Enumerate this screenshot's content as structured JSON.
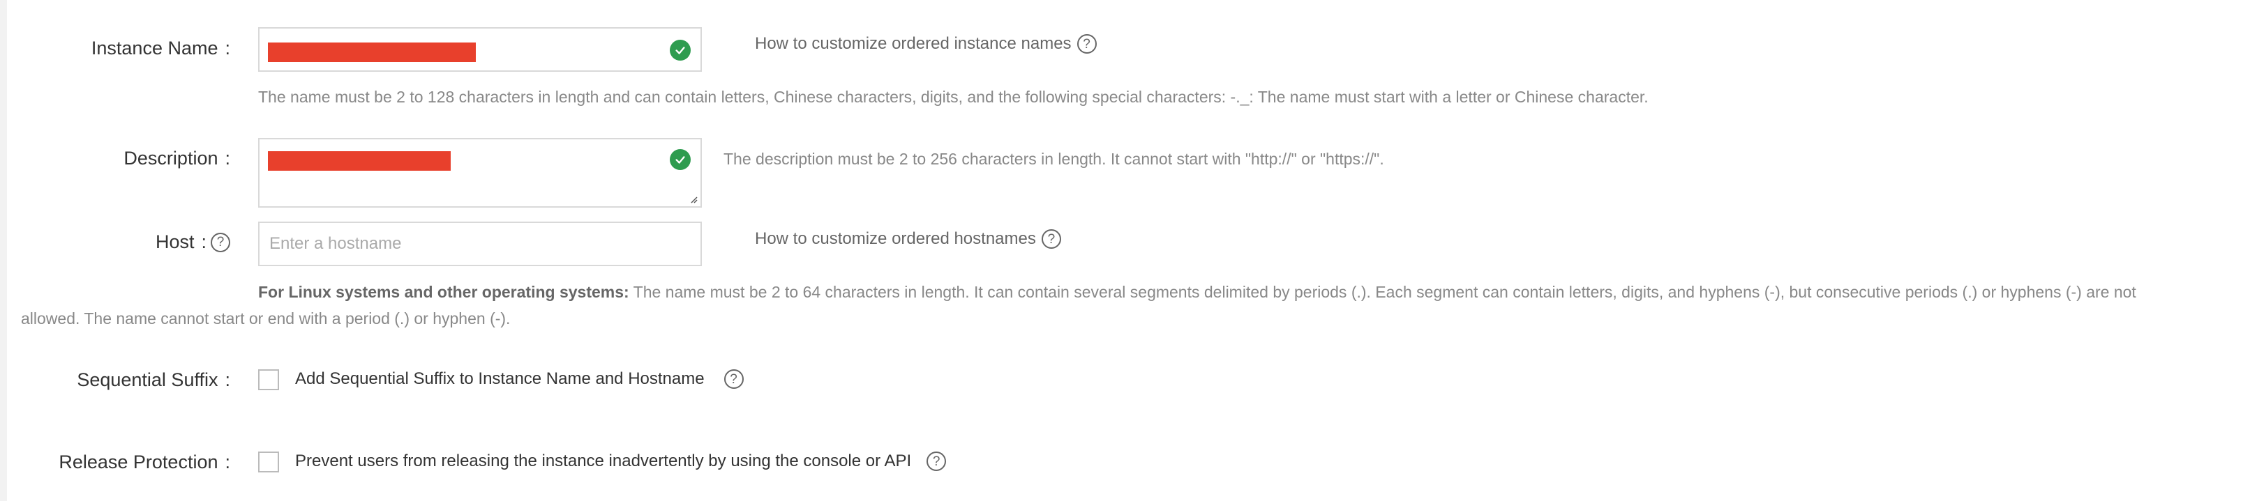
{
  "instance_name": {
    "label": "Instance Name",
    "help_link": "How to customize ordered instance names",
    "hint": "The name must be 2 to 128 characters in length and can contain letters, Chinese characters, digits, and the following special characters: -._: The name must start with a letter or Chinese character.",
    "redaction_color": "#e8402c",
    "valid_color": "#2e9c4f"
  },
  "description": {
    "label": "Description",
    "hint": "The description must be 2 to 256 characters in length. It cannot start with \"http://\" or \"https://\"."
  },
  "host": {
    "label": "Host",
    "placeholder": "Enter a hostname",
    "help_link": "How to customize ordered hostnames",
    "hint_bold": "For Linux systems and other operating systems:",
    "hint_line1": " The name must be 2 to 64 characters in length. It can contain several segments delimited by periods (.). Each segment can contain letters, digits, and hyphens (-), but consecutive periods (.) or hyphens (-) are not",
    "hint_line2": "allowed. The name cannot start or end with a period (.) or hyphen (-)."
  },
  "sequential_suffix": {
    "label": "Sequential Suffix",
    "checkbox_label": "Add Sequential Suffix to Instance Name and Hostname",
    "checked": false
  },
  "release_protection": {
    "label": "Release Protection",
    "checkbox_label": "Prevent users from releasing the instance inadvertently by using the console or API",
    "checked": false
  },
  "common": {
    "colon": ":",
    "help_glyph": "?"
  }
}
